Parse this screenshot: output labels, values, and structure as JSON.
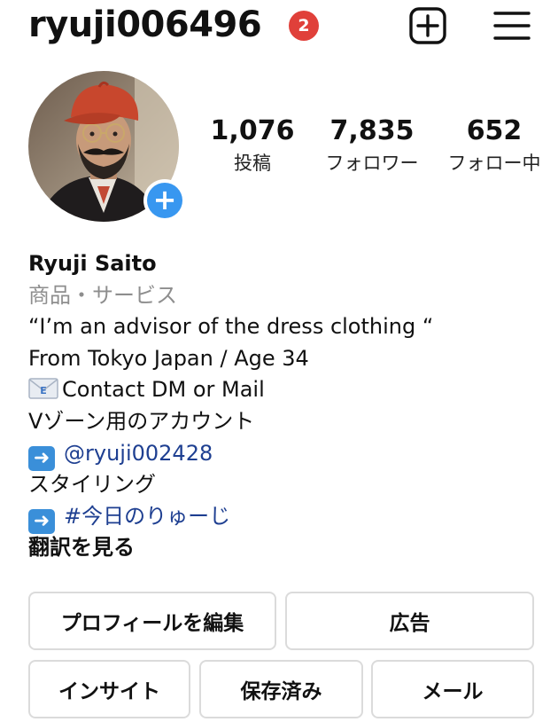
{
  "header": {
    "username": "ryuji006496",
    "notification_count": "2",
    "new_post_icon": "plus-square-icon",
    "menu_icon": "hamburger-menu-icon"
  },
  "profile": {
    "avatar": "profile-photo",
    "add_story_icon": "plus-icon"
  },
  "stats": [
    {
      "value": "1,076",
      "label": "投稿"
    },
    {
      "value": "7,835",
      "label": "フォロワー"
    },
    {
      "value": "652",
      "label": "フォロー中"
    }
  ],
  "bio": {
    "name": "Ryuji Saito",
    "category": "商品・サービス",
    "line1": "“I’m an advisor of the dress clothing “",
    "line2": "From Tokyo Japan / Age 34",
    "line3": "Contact DM or Mail",
    "line4": "Vゾーン用のアカウント",
    "mention": "@ryuji002428",
    "line6": "スタイリング",
    "hashtag": "#今日のりゅーじ",
    "translate": "翻訳を見る",
    "arrow_icon": "right-arrow-emoji",
    "mail_icon": "incoming-envelope-emoji"
  },
  "buttons": {
    "edit_profile": "プロフィールを編集",
    "ads": "広告",
    "insights": "インサイト",
    "saved": "保存済み",
    "mail": "メール"
  },
  "colors": {
    "badge": "#e0403a",
    "add_story": "#3897f0",
    "link": "#1e3f91",
    "muted": "#8e8e8e",
    "border": "#dbdbdb"
  }
}
